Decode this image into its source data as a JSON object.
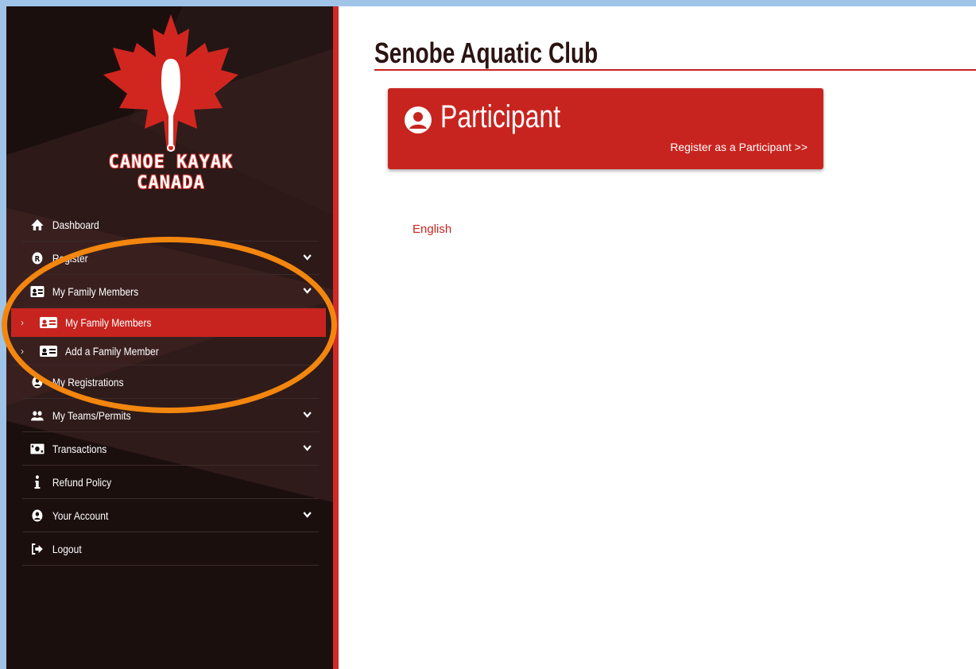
{
  "logo": {
    "line1": "CANOE KAYAK",
    "line2": "CANADA"
  },
  "main": {
    "title": "Senobe Aquatic Club",
    "card": {
      "title": "Participant",
      "link": "Register as a Participant >>"
    },
    "language_link": "English"
  },
  "sidebar": {
    "items": [
      {
        "label": "Dashboard",
        "icon": "home-icon",
        "chevron": false
      },
      {
        "label": "Register",
        "icon": "registered-icon",
        "chevron": true
      },
      {
        "label": "My Family Members",
        "icon": "id-card-icon",
        "chevron": true
      },
      {
        "label": "My Registrations",
        "icon": "user-circle-icon",
        "chevron": false
      },
      {
        "label": "My Teams/Permits",
        "icon": "users-icon",
        "chevron": true
      },
      {
        "label": "Transactions",
        "icon": "money-icon",
        "chevron": true
      },
      {
        "label": "Refund Policy",
        "icon": "info-icon",
        "chevron": false
      },
      {
        "label": "Your Account",
        "icon": "user-circle-icon",
        "chevron": true
      },
      {
        "label": "Logout",
        "icon": "logout-icon",
        "chevron": false
      }
    ],
    "family_sub": [
      {
        "label": "My Family Members",
        "active": true
      },
      {
        "label": "Add a Family Member",
        "active": false
      }
    ]
  },
  "colors": {
    "accent": "#c8241f",
    "sidebar_bg": "#1b0f0e",
    "highlight": "#f3860f",
    "outer_bg": "#9fc4e8"
  }
}
